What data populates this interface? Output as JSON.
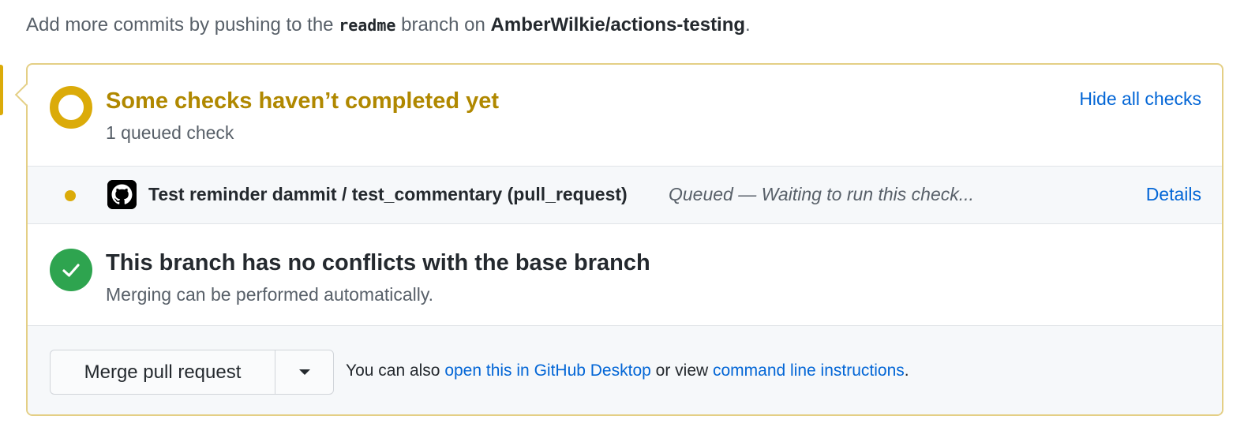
{
  "intro": {
    "prefix": "Add more commits by pushing to the ",
    "branch": "readme",
    "middle": " branch on ",
    "repo": "AmberWilkie/actions-testing",
    "suffix": "."
  },
  "checks_status": {
    "title": "Some checks haven’t completed yet",
    "subtitle": "1 queued check",
    "hide_link": "Hide all checks"
  },
  "check_rows": [
    {
      "name": "Test reminder dammit / test_commentary (pull_request)",
      "status": "Queued — Waiting to run this check...",
      "details": "Details"
    }
  ],
  "merge_status": {
    "title": "This branch has no conflicts with the base branch",
    "subtitle": "Merging can be performed automatically."
  },
  "actions": {
    "merge_button": "Merge pull request",
    "also_prefix": "You can also ",
    "desktop_link": "open this in GitHub Desktop",
    "also_middle": " or view ",
    "cli_link": "command line instructions",
    "also_suffix": "."
  },
  "colors": {
    "pending": "#dbab09",
    "pending_text": "#b08800",
    "success": "#2ea44f",
    "link": "#0366d6",
    "panel_border": "#e4cf85"
  }
}
